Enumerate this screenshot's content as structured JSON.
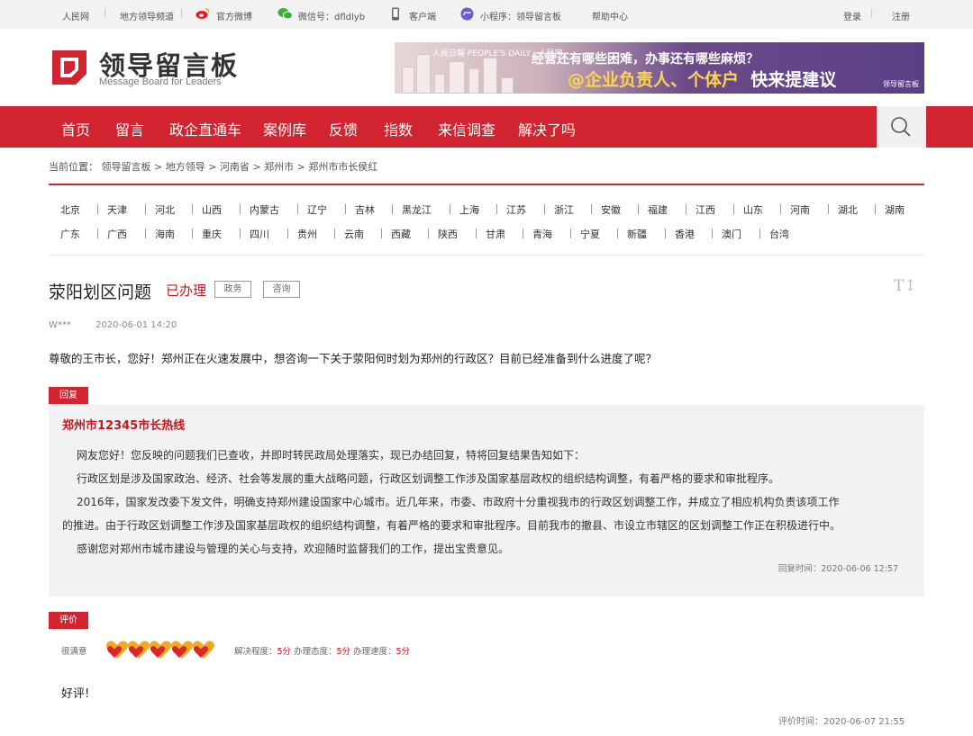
{
  "topbar": {
    "people": "人民网",
    "channel": "地方领导频道",
    "weibo": "官方微博",
    "wechat": "微信号：dfldlyb",
    "client": "客户端",
    "miniprogram": "小程序：领导留言板",
    "help": "帮助中心",
    "login": "登录",
    "register": "注册"
  },
  "header": {
    "title": "领导留言板",
    "subtitle": "Message Board for Leaders"
  },
  "banner": {
    "logo_left": "人民日報 PEOPLE'S DAILY · 人民网",
    "line1": "经营还有哪些困难，办事还有哪些麻烦？",
    "line2_a": "@企业负责人、个体户",
    "line2_b": "快来提建议",
    "logo_right": "领导留言板"
  },
  "nav": {
    "items": [
      "首页",
      "留言",
      "政企直通车",
      "案例库",
      "反馈",
      "指数",
      "来信调查",
      "解决了吗"
    ]
  },
  "breadcrumb": {
    "prefix": "当前位置：",
    "items": [
      "领导留言板",
      "地方领导",
      "河南省",
      "郑州市",
      "郑州市市长侯红"
    ],
    "separator": ">"
  },
  "provinces": {
    "row1": [
      "北京",
      "天津",
      "河北",
      "山西",
      "内蒙古",
      "辽宁",
      "吉林",
      "黑龙江",
      "上海",
      "江苏",
      "浙江",
      "安徽",
      "福建",
      "江西",
      "山东",
      "河南",
      "湖北",
      "湖南"
    ],
    "row2": [
      "广东",
      "广西",
      "海南",
      "重庆",
      "四川",
      "贵州",
      "云南",
      "西藏",
      "陕西",
      "甘肃",
      "青海",
      "宁夏",
      "新疆",
      "香港",
      "澳门",
      "台湾"
    ]
  },
  "message": {
    "title": "荥阳划区问题",
    "status": "已办理",
    "tags": [
      "政务",
      "咨询"
    ],
    "font_tool": "T↕",
    "author": "W***",
    "time": "2020-06-01 14:20",
    "body": "尊敬的王市长，您好！郑州正在火速发展中，想咨询一下关于荥阳何时划为郑州的行政区？目前已经准备到什么进度了呢？"
  },
  "reply": {
    "label": "回复",
    "from": "郑州市12345市长热线",
    "lines": [
      "网友您好！您反映的问题我们已查收，并即时转民政局处理落实，现已办结回复，特将回复结果告知如下：",
      "行政区划是涉及国家政治、经济、社会等发展的重大战略问题，行政区划调整工作涉及国家基层政权的组织结构调整，有着严格的要求和审批程序。",
      "2016年，国家发改委下发文件，明确支持郑州建设国家中心城市。近几年来，市委、市政府十分重视我市的行政区划调整工作，并成立了相应机构负责该项工作",
      "的推进。由于行政区划调整工作涉及国家基层政权的组织结构调整，有着严格的要求和审批程序。目前我市的撤县、市设立市辖区的区划调整工作正在积极进行中。",
      "感谢您对郑州市城市建设与管理的关心与支持，欢迎随时监督我们的工作，提出宝贵意见。"
    ],
    "time_label": "回复时间：",
    "time": "2020-06-06 12:57"
  },
  "evaluation": {
    "label": "评价",
    "overall": "很满意",
    "hearts": 5,
    "resolution_label": "解决程度：",
    "resolution_value": "5分",
    "attitude_label": "办理态度：",
    "attitude_value": "5分",
    "speed_label": "办理速度：",
    "speed_value": "5分",
    "comment": "好评!",
    "time_label": "评价时间：",
    "time": "2020-06-07 21:55"
  },
  "colors": {
    "brand_red": "#d12430",
    "status_red": "#c8161d",
    "heart_orange": "#f5a623",
    "heart_red": "#d9272e"
  }
}
